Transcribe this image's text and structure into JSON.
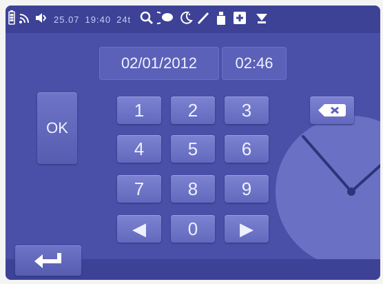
{
  "status_bar": {
    "temperature": "25.07",
    "time": "19:40",
    "mode": "24t",
    "icons": [
      "battery-icon",
      "signal-icon",
      "speaker-icon",
      "search-icon",
      "chat-icon",
      "moon-icon",
      "pen-icon",
      "person-icon",
      "plus-icon",
      "download-icon"
    ]
  },
  "display": {
    "date": "02/01/2012",
    "time": "02:46"
  },
  "keypad": {
    "ok_label": "OK",
    "keys": [
      "1",
      "2",
      "3",
      "4",
      "5",
      "6",
      "7",
      "8",
      "9",
      "◀",
      "0",
      "▶"
    ]
  },
  "colors": {
    "background": "#4a4fa8",
    "status_bar": "#3d4297",
    "key": "#6b71c7",
    "text": "#eef0ff"
  }
}
